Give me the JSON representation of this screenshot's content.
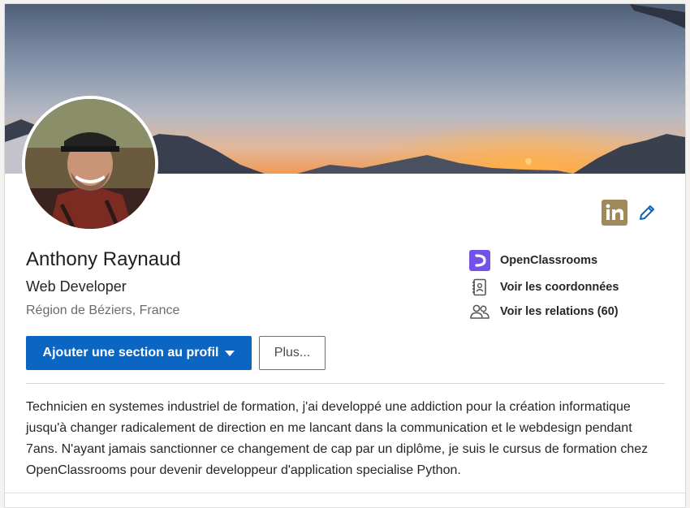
{
  "profile": {
    "name": "Anthony Raynaud",
    "headline": "Web Developer",
    "location": "Région de Béziers, France"
  },
  "actions": {
    "add_section_label": "Ajouter une section au profil",
    "more_label": "Plus..."
  },
  "side_links": {
    "company": "OpenClassrooms",
    "contact": "Voir les coordonnées",
    "connections": "Voir les relations (60)"
  },
  "summary": "Technicien en systemes industriel de formation, j'ai developpé une addiction pour la création informatique jusqu'à changer radicalement de direction en me lancant dans la communication et le webdesign pendant 7ans. N'ayant jamais sanctionner ce changement de cap par un diplôme, je suis le cursus de formation chez OpenClassrooms pour devenir developpeur d'application specialise Python.",
  "icons": {
    "linkedin": "linkedin-logo-icon",
    "edit": "pencil-icon",
    "company": "openclassrooms-logo-icon",
    "contact": "address-book-icon",
    "connections": "people-icon"
  },
  "colors": {
    "primary_button": "#0a66c2",
    "linkedin_badge": "#a0895a",
    "edit_icon": "#0a66c2",
    "openclassrooms": "#7451eb"
  }
}
